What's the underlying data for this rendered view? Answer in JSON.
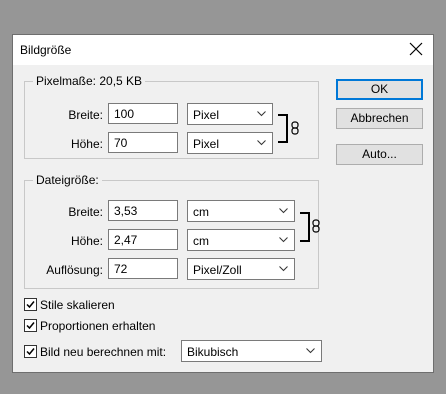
{
  "dialog": {
    "title": "Bildgröße",
    "pixel_dimensions": {
      "heading": "Pixelmaße: 20,5 KB",
      "width_label": "Breite:",
      "width_value": "100",
      "width_unit": "Pixel",
      "height_label": "Höhe:",
      "height_value": "70",
      "height_unit": "Pixel"
    },
    "document_size": {
      "heading": "Dateigröße:",
      "width_label": "Breite:",
      "width_value": "3,53",
      "width_unit": "cm",
      "height_label": "Höhe:",
      "height_value": "2,47",
      "height_unit": "cm",
      "resolution_label": "Auflösung:",
      "resolution_value": "72",
      "resolution_unit": "Pixel/Zoll"
    },
    "buttons": {
      "ok": "OK",
      "cancel": "Abbrechen",
      "auto": "Auto..."
    },
    "options": {
      "scale_styles": {
        "label": "Stile skalieren",
        "checked": true
      },
      "constrain": {
        "label": "Proportionen erhalten",
        "checked": true
      },
      "resample": {
        "label": "Bild neu berechnen mit:",
        "checked": true
      },
      "resample_method": "Bikubisch"
    }
  },
  "colors": {
    "backdrop": "#969696",
    "dialog_bg": "#f0f0f0",
    "accent": "#0078d7"
  }
}
